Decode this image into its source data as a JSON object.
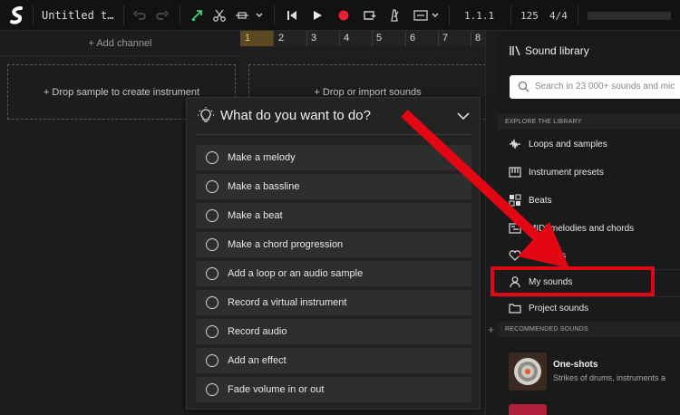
{
  "topbar": {
    "title": "Untitled t…",
    "position": "1.1.1",
    "tempo": "125",
    "time_signature": "4/4"
  },
  "left": {
    "add_channel": "+ Add channel",
    "drop_sample": "+ Drop sample to create instrument"
  },
  "timeline": {
    "bars": [
      "1",
      "2",
      "3",
      "4",
      "5",
      "6",
      "7",
      "8"
    ],
    "drop_import": "+ Drop or import sounds"
  },
  "modal": {
    "title": "What do you want to do?",
    "options": [
      "Make a melody",
      "Make a bassline",
      "Make a beat",
      "Make a chord progression",
      "Add a loop or an audio sample",
      "Record a virtual instrument",
      "Record audio",
      "Add an effect",
      "Fade volume in or out"
    ]
  },
  "library": {
    "title": "Sound library",
    "search_placeholder": "Search in 23 000+ sounds and mic",
    "explore_label": "EXPLORE THE LIBRARY",
    "items": [
      {
        "label": "Loops and samples",
        "icon": "waveform-icon"
      },
      {
        "label": "Instrument presets",
        "icon": "keyboard-icon"
      },
      {
        "label": "Beats",
        "icon": "drum-grid-icon"
      },
      {
        "label": "MIDI melodies and chords",
        "icon": "midi-icon"
      },
      {
        "label": "Favorites",
        "icon": "heart-icon"
      }
    ],
    "my_sounds": "My sounds",
    "project_sounds": "Project sounds",
    "recommended_label": "RECOMMENDED SOUNDS",
    "card_title": "One-shots",
    "card_subtitle": "Strikes of drums, instruments a"
  },
  "colors": {
    "highlight": "#e30613",
    "record": "#e8202f",
    "accent_green": "#3ad37a",
    "bar_one": "#e8c66a"
  }
}
